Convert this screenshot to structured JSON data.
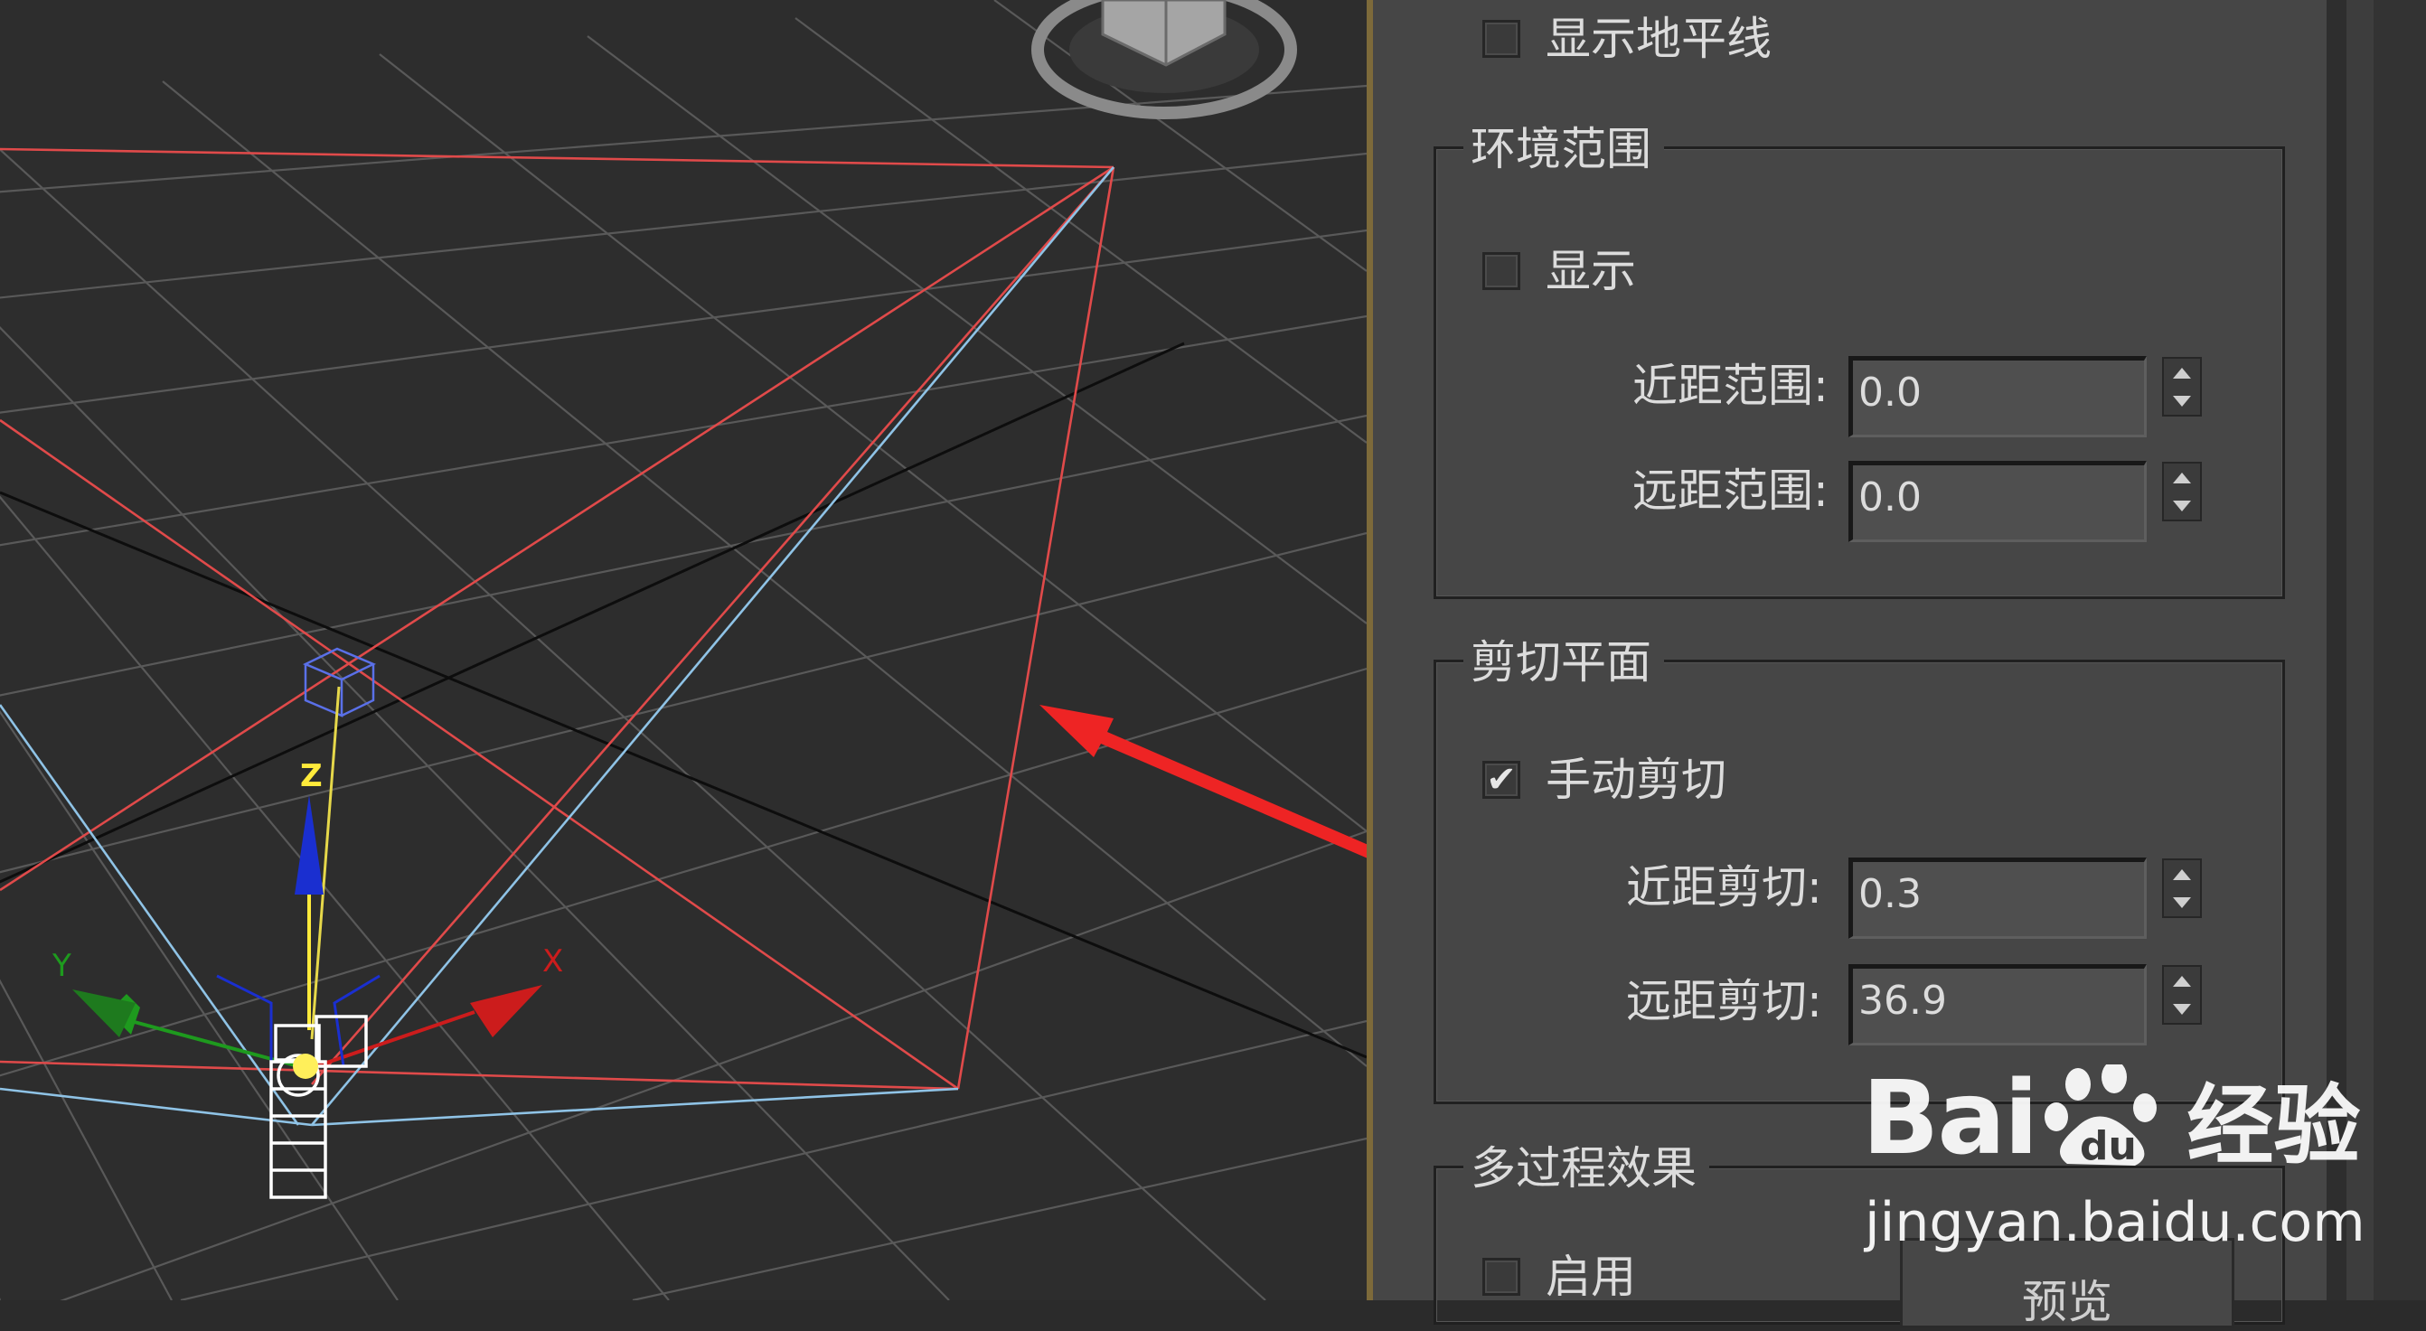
{
  "panel": {
    "show_horizon_label": "显示地平线",
    "show_horizon_checked": false,
    "env_range": {
      "title": "环境范围",
      "show_label": "显示",
      "show_checked": false,
      "near_label": "近距范围:",
      "near_value": "0.0",
      "far_label": "远距范围:",
      "far_value": "0.0"
    },
    "clip": {
      "title": "剪切平面",
      "manual_label": "手动剪切",
      "manual_checked": true,
      "manual_check_glyph": "✔",
      "near_label": "近距剪切:",
      "near_value": "0.3",
      "far_label": "远距剪切:",
      "far_value": "36.9"
    },
    "multipass": {
      "title": "多过程效果",
      "enable_label": "启用",
      "enable_checked": false,
      "preview_label": "预览"
    }
  },
  "viewport": {
    "gizmo_labels": {
      "z": "Z",
      "y": "Y",
      "x": "X"
    },
    "colors": {
      "frustum_red": "#e04a4a",
      "frustum_blue": "#8fc3e6",
      "grid": "#5a5a5a",
      "axis_black": "#0d0d0d",
      "gizmo_z": "#1a2fd0",
      "gizmo_y": "#1e9a1e",
      "gizmo_x": "#cc1c1c",
      "arrow": "#ee2424"
    }
  },
  "watermark": {
    "brand_left": "Bai",
    "brand_paw_text": "du",
    "brand_cn": "经验",
    "url": "jingyan.baidu.com"
  }
}
